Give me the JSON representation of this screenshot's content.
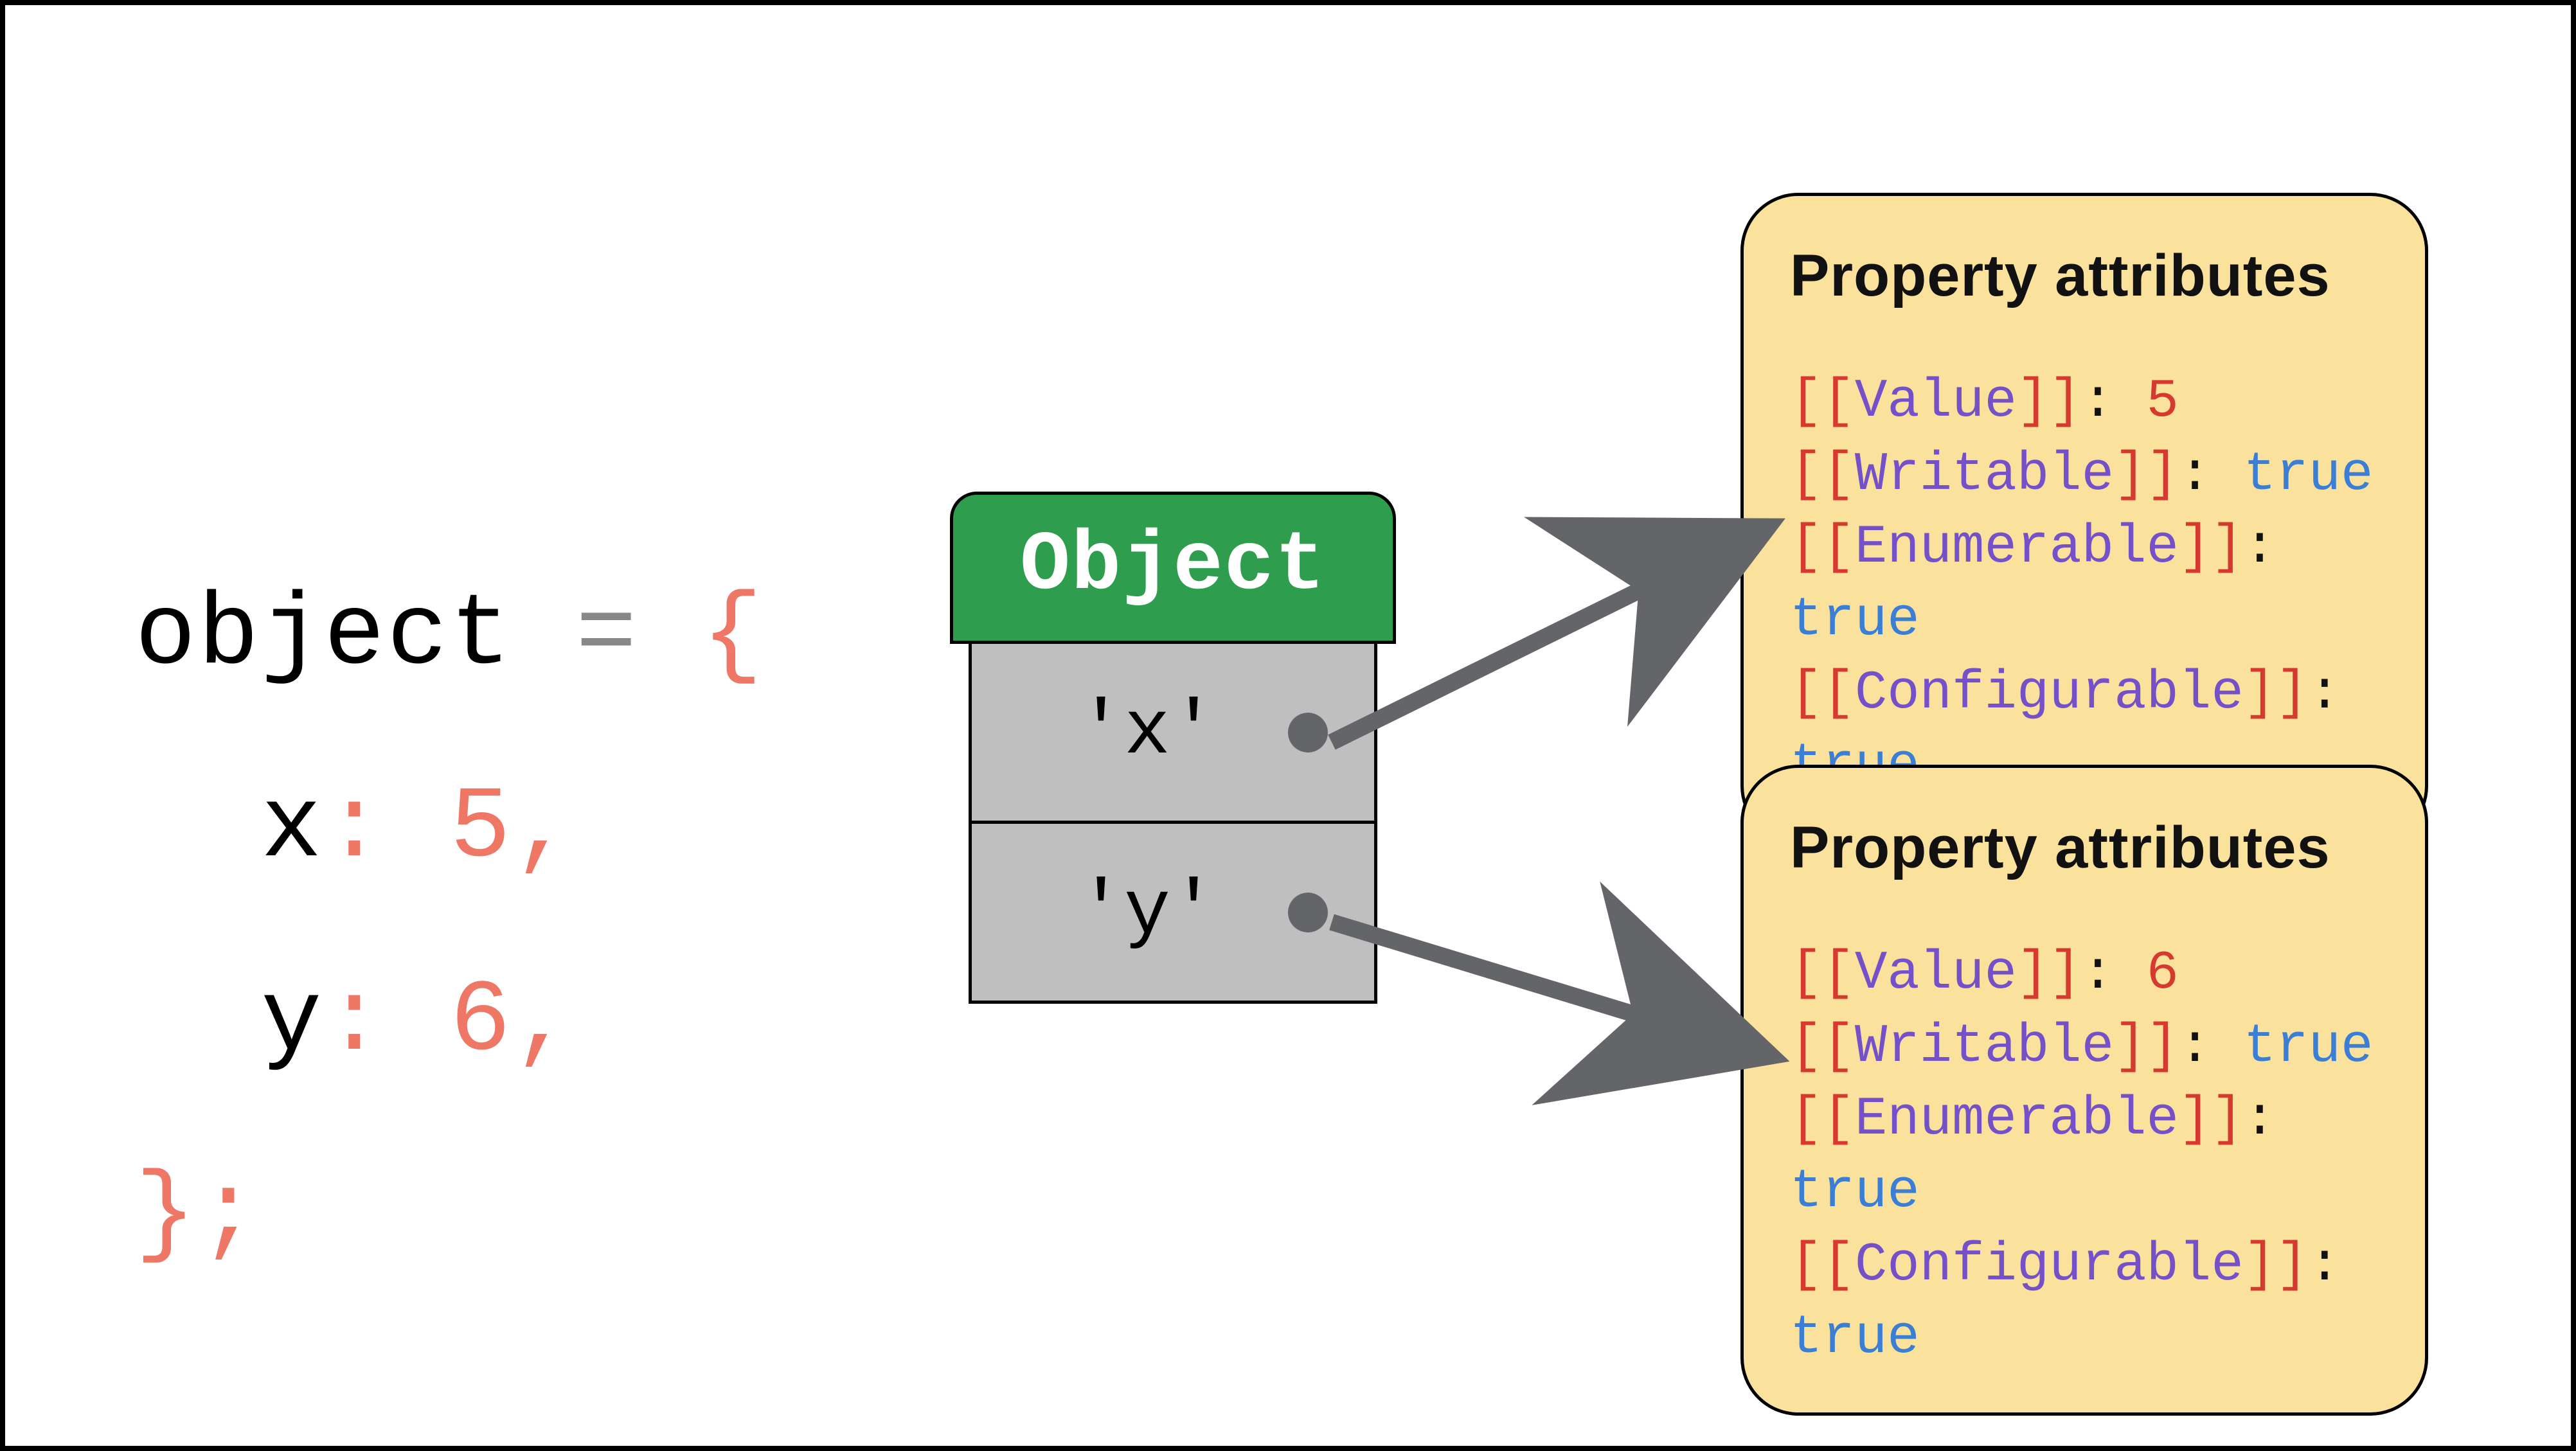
{
  "code": {
    "line1_var": "object",
    "line1_eq": " = ",
    "line1_brace": "{",
    "line2_key": "x",
    "line2_colonval": ": 5,",
    "line3_key": "y",
    "line3_colonval": ": 6,",
    "line4": "};"
  },
  "object_box": {
    "header": "Object",
    "row1_key": "'x'",
    "row2_key": "'y'"
  },
  "attr_top": {
    "title": "Property attributes",
    "rows": [
      {
        "br_open": "[[",
        "name": "Value",
        "br_close": "]]",
        "colon": ": ",
        "val": "5",
        "val_class": "a-red"
      },
      {
        "br_open": "[[",
        "name": "Writable",
        "br_close": "]]",
        "colon": ": ",
        "val": "true",
        "val_class": "a-blue"
      },
      {
        "br_open": "[[",
        "name": "Enumerable",
        "br_close": "]]",
        "colon": ": ",
        "val": "true",
        "val_class": "a-blue"
      },
      {
        "br_open": "[[",
        "name": "Configurable",
        "br_close": "]]",
        "colon": ": ",
        "val": "true",
        "val_class": "a-blue"
      }
    ]
  },
  "attr_bot": {
    "title": "Property attributes",
    "rows": [
      {
        "br_open": "[[",
        "name": "Value",
        "br_close": "]]",
        "colon": ": ",
        "val": "6",
        "val_class": "a-red"
      },
      {
        "br_open": "[[",
        "name": "Writable",
        "br_close": "]]",
        "colon": ": ",
        "val": "true",
        "val_class": "a-blue"
      },
      {
        "br_open": "[[",
        "name": "Enumerable",
        "br_close": "]]",
        "colon": ": ",
        "val": "true",
        "val_class": "a-blue"
      },
      {
        "br_open": "[[",
        "name": "Configurable",
        "br_close": "]]",
        "colon": ": ",
        "val": "true",
        "val_class": "a-blue"
      }
    ]
  },
  "colors": {
    "coral": "#ee7766",
    "green": "#2e9e4e",
    "gray_box": "#bfbfbf",
    "arrow": "#646568",
    "yellow": "#fae29c",
    "purple": "#7451c8",
    "blue": "#3a7fd5",
    "red": "#d63a2f"
  }
}
